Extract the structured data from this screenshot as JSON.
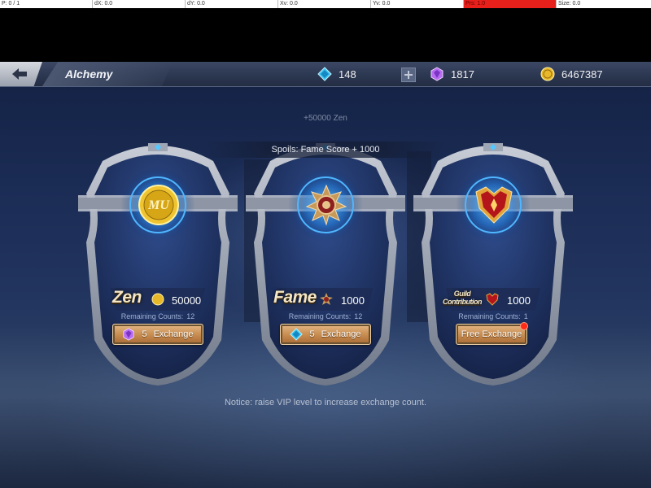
{
  "debug": {
    "p": "P: 0 / 1",
    "dx": "dX: 0.0",
    "dy": "dY: 0.0",
    "xv": "Xv: 0.0",
    "yv": "Yv: 0.0",
    "prs": "Prs: 1.0",
    "size": "Size: 0.0"
  },
  "header": {
    "title": "Alchemy",
    "diamonds": "148",
    "gems": "1817",
    "gold": "6467387"
  },
  "banner": "+50000 Zen",
  "spoils": "Spoils: Fame Score + 1000",
  "cards": [
    {
      "reward_name": "Zen",
      "reward_icon": "zen-coin-icon",
      "reward_amount": "50000",
      "remaining_label": "Remaining Counts:",
      "remaining_value": "12",
      "cost_icon": "purple-gem-icon",
      "cost": "5",
      "button_label": "Exchange"
    },
    {
      "reward_name": "Fame",
      "reward_icon": "fame-medal-icon",
      "reward_amount": "1000",
      "remaining_label": "Remaining Counts:",
      "remaining_value": "12",
      "cost_icon": "blue-diamond-icon",
      "cost": "5",
      "button_label": "Exchange"
    },
    {
      "reward_name_line1": "Guild",
      "reward_name_line2": "Contribution",
      "reward_icon": "guild-crest-icon",
      "reward_amount": "1000",
      "remaining_label": "Remaining Counts:",
      "remaining_value": "1",
      "button_label": "Free Exchange"
    }
  ],
  "notice": "Notice: raise VIP level to increase exchange count.",
  "colors": {
    "gold_text": "#f5e6c4",
    "button_bronze": "#c98e52",
    "remaining_text": "#9fb1d4",
    "alert_red": "#ff2a18"
  }
}
